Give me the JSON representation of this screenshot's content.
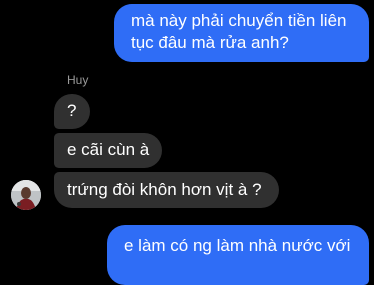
{
  "conversation": {
    "outgoing": [
      {
        "line1": "mà này phải chuyển tiền liên",
        "line2": "tục đâu mà rửa anh?"
      },
      {
        "line1": "e làm có ng làm nhà nước với"
      }
    ],
    "incoming_sender": "Huy",
    "incoming": [
      {
        "text": "?"
      },
      {
        "text": "e cãi cùn à"
      },
      {
        "text": "trứng đòi khôn hơn vịt à ?"
      }
    ]
  },
  "colors": {
    "outgoing_bubble": "#2f6df6",
    "incoming_bubble": "#303030",
    "background": "#000000"
  }
}
